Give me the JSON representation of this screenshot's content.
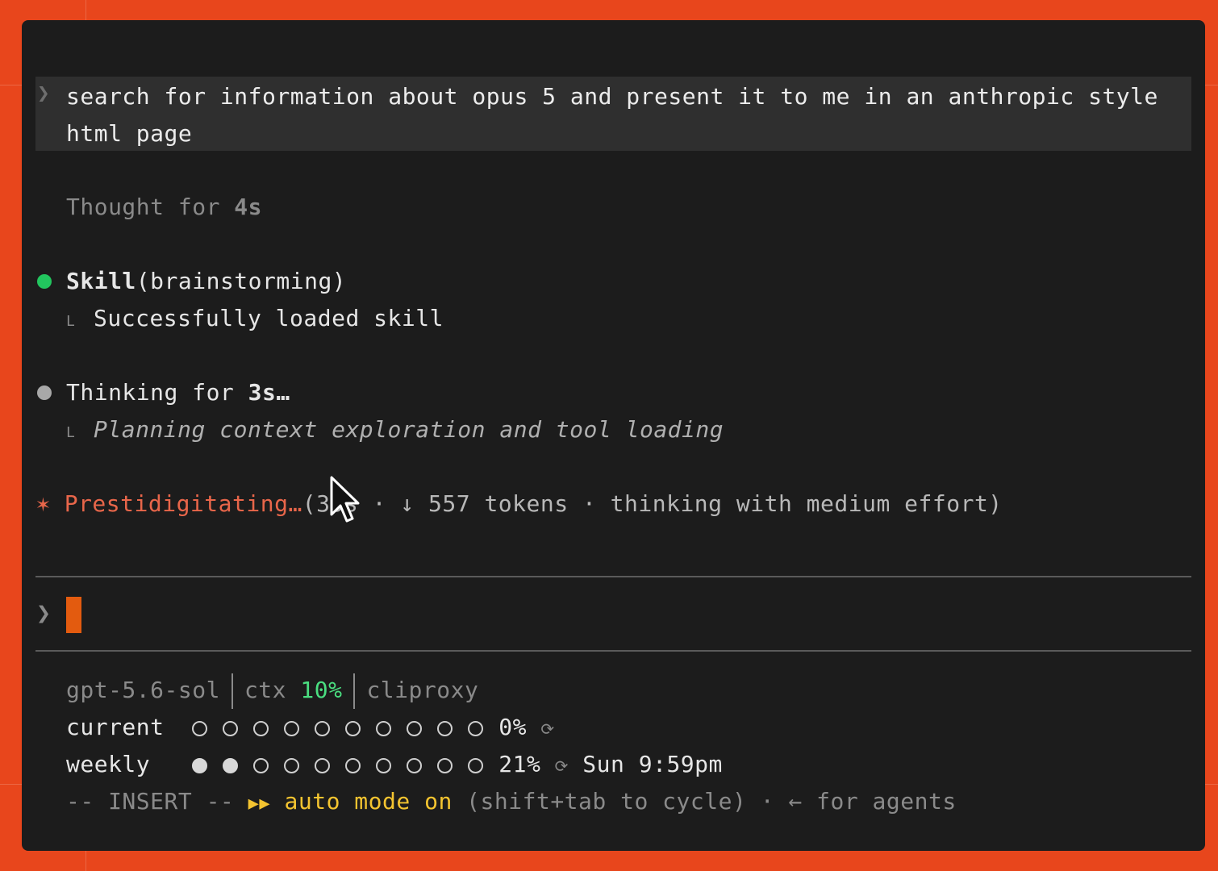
{
  "prompt": {
    "text": "search for information about opus 5 and present it to me in an anthropic style html page"
  },
  "thought": {
    "prefix": "Thought for ",
    "duration": "4s"
  },
  "skill": {
    "name": "Skill",
    "arg": "(brainstorming)",
    "result": "Successfully loaded skill",
    "status_color": "#22c55e"
  },
  "thinking": {
    "prefix": "Thinking for ",
    "duration": "3s…",
    "detail": "Planning context exploration and tool loading"
  },
  "activity": {
    "star": "✶",
    "verb": "Prestidigitating…",
    "rest": "(39s · ↓ 557 tokens · thinking with medium effort)"
  },
  "input": {
    "caret": "❯",
    "value": ""
  },
  "status": {
    "model": "gpt-5.6-sol",
    "ctx_label": "ctx",
    "ctx_value": "10%",
    "provider": "cliproxy",
    "current_label": "current",
    "current_filled": 0,
    "current_pct": "0%",
    "weekly_label": "weekly",
    "weekly_filled": 2,
    "weekly_pct": "21%",
    "reset_icon": "⟳",
    "weekly_reset": "Sun 9:59pm",
    "total_dots": 10,
    "mode_prefix": "-- INSERT --",
    "mode_icon": "▶▶",
    "mode_text": "auto mode on",
    "mode_hint": "(shift+tab to cycle)",
    "mode_sep": "·",
    "agents_hint": "← for agents"
  }
}
